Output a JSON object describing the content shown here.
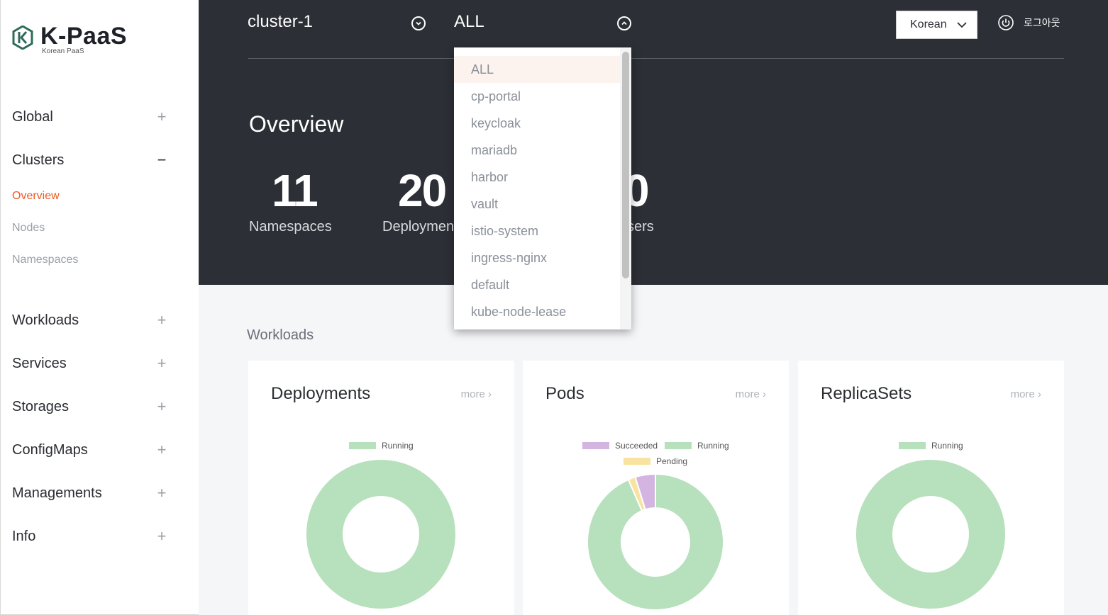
{
  "logo": {
    "name": "K-PaaS",
    "sub": "Korean PaaS"
  },
  "sidebar": {
    "items": [
      {
        "label": "Global",
        "sign": "+"
      },
      {
        "label": "Clusters",
        "sign": "−"
      },
      {
        "label": "Workloads",
        "sign": "+"
      },
      {
        "label": "Services",
        "sign": "+"
      },
      {
        "label": "Storages",
        "sign": "+"
      },
      {
        "label": "ConfigMaps",
        "sign": "+"
      },
      {
        "label": "Managements",
        "sign": "+"
      },
      {
        "label": "Info",
        "sign": "+"
      }
    ],
    "cluster_sub": [
      "Overview",
      "Nodes",
      "Namespaces"
    ],
    "active_sub": "Overview"
  },
  "header": {
    "cluster": "cluster-1",
    "namespace": "ALL",
    "language": "Korean",
    "logout": "로그아웃"
  },
  "namespace_dropdown": {
    "options": [
      "ALL",
      "cp-portal",
      "keycloak",
      "mariadb",
      "harbor",
      "vault",
      "istio-system",
      "ingress-nginx",
      "default",
      "kube-node-lease"
    ],
    "selected": "ALL"
  },
  "overview": {
    "title": "Overview",
    "stats": [
      {
        "value": "11",
        "label": "Namespaces"
      },
      {
        "value": "20",
        "label": "Deploymen"
      },
      {
        "value": "0",
        "label": "Jsers"
      }
    ]
  },
  "workloads": {
    "title": "Workloads",
    "more_label": "more ›",
    "cards": [
      {
        "title": "Deployments",
        "legend": [
          {
            "name": "Running",
            "color": "#b7e0bc"
          }
        ]
      },
      {
        "title": "Pods",
        "legend": [
          {
            "name": "Succeeded",
            "color": "#d4b4e0"
          },
          {
            "name": "Running",
            "color": "#b7e0bc"
          },
          {
            "name": "Pending",
            "color": "#f8e3a0"
          }
        ]
      },
      {
        "title": "ReplicaSets",
        "legend": [
          {
            "name": "Running",
            "color": "#b7e0bc"
          }
        ]
      }
    ]
  },
  "chart_data": [
    {
      "type": "pie",
      "title": "Deployments",
      "categories": [
        "Running"
      ],
      "values": [
        100
      ]
    },
    {
      "type": "pie",
      "title": "Pods",
      "categories": [
        "Running",
        "Pending",
        "Succeeded"
      ],
      "values": [
        93.5,
        1.7,
        4.8
      ]
    },
    {
      "type": "pie",
      "title": "ReplicaSets",
      "categories": [
        "Running"
      ],
      "values": [
        100
      ]
    }
  ]
}
